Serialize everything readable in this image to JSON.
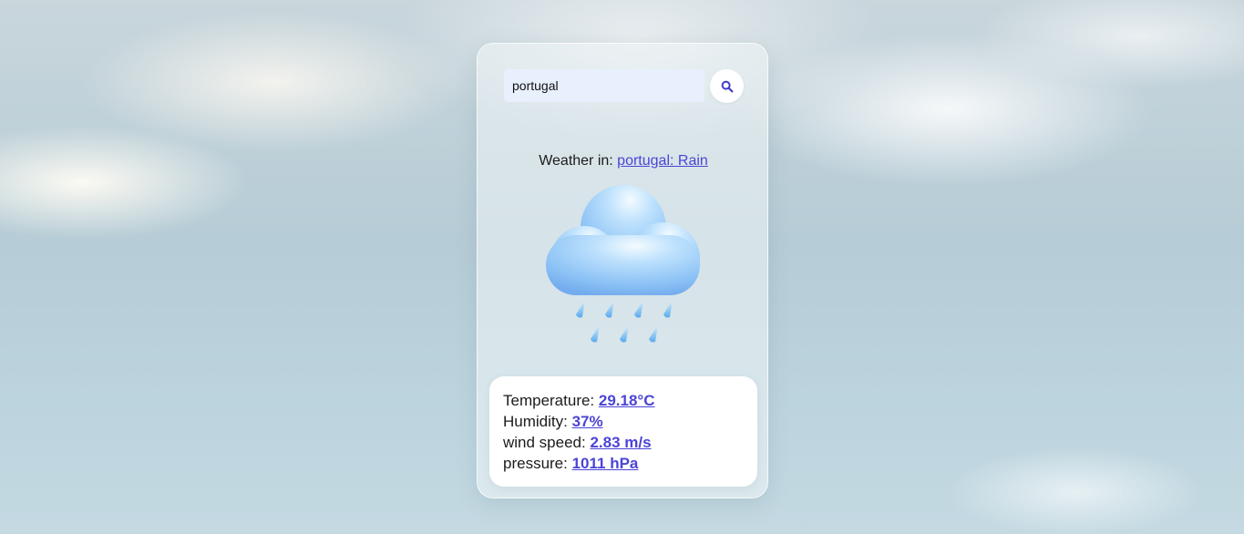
{
  "search": {
    "value": "portugal",
    "placeholder": ""
  },
  "icons": {
    "search_button": "search-icon",
    "weather": "rain-cloud-icon"
  },
  "headline": {
    "prefix": "Weather in: ",
    "link_text": "portugal: Rain"
  },
  "details": {
    "temperature": {
      "label": "Temperature: ",
      "value": "29.18°C"
    },
    "humidity": {
      "label": "Humidity: ",
      "value": "37%"
    },
    "wind_speed": {
      "label": "wind speed: ",
      "value": "2.83 m/s"
    },
    "pressure": {
      "label": "pressure: ",
      "value": "1011 hPa"
    }
  },
  "colors": {
    "accent": "#4b44d6",
    "input_bg": "#e8f0fe",
    "card_bg": "#ffffff"
  }
}
